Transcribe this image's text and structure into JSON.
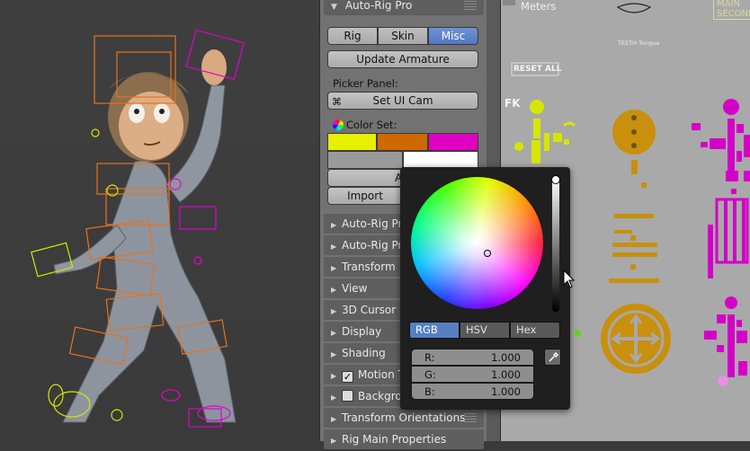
{
  "addon_panel": {
    "title": "Auto-Rig Pro",
    "tabs": [
      {
        "label": "Rig",
        "active": false
      },
      {
        "label": "Skin",
        "active": false
      },
      {
        "label": "Misc",
        "active": true
      }
    ],
    "update_button": "Update Armature",
    "picker_panel_label": "Picker Panel:",
    "set_ui_cam_button": "Set UI Cam",
    "color_set_label": "Color Set:",
    "color_set_swatches": [
      "#e6f000",
      "#cc6a00",
      "#e000c0"
    ],
    "assign_button": "Ass",
    "import_button": "Import"
  },
  "sections": [
    {
      "label": "Auto-Rig Pro",
      "checkbox": false
    },
    {
      "label": "Auto-Rig Pro",
      "checkbox": false
    },
    {
      "label": "Transform",
      "checkbox": false
    },
    {
      "label": "View",
      "checkbox": false
    },
    {
      "label": "3D Cursor",
      "checkbox": false
    },
    {
      "label": "Display",
      "checkbox": false
    },
    {
      "label": "Shading",
      "checkbox": false
    },
    {
      "label": "Motion T",
      "checkbox": true,
      "checked": true
    },
    {
      "label": "Backgro",
      "checkbox": true,
      "checked": false
    },
    {
      "label": "Transform Orientations",
      "checkbox": false
    },
    {
      "label": "Rig Main Properties",
      "checkbox": false
    }
  ],
  "color_popup": {
    "modes": [
      {
        "label": "RGB",
        "active": true
      },
      {
        "label": "HSV",
        "active": false
      },
      {
        "label": "Hex",
        "active": false
      }
    ],
    "fields": [
      {
        "label": "R:",
        "value": "1.000"
      },
      {
        "label": "G:",
        "value": "1.000"
      },
      {
        "label": "B:",
        "value": "1.000"
      }
    ]
  },
  "picker_view": {
    "units_label": "Meters",
    "reset_all_button": "RESET ALL",
    "fk_label": "FK",
    "main_label_line1": "MAIN",
    "main_label_line2": "SECOND",
    "small_caption": "TEETH Tongue",
    "accent_orange": "#c8900c",
    "accent_yellow": "#d7e600",
    "accent_magenta": "#d400c8"
  }
}
